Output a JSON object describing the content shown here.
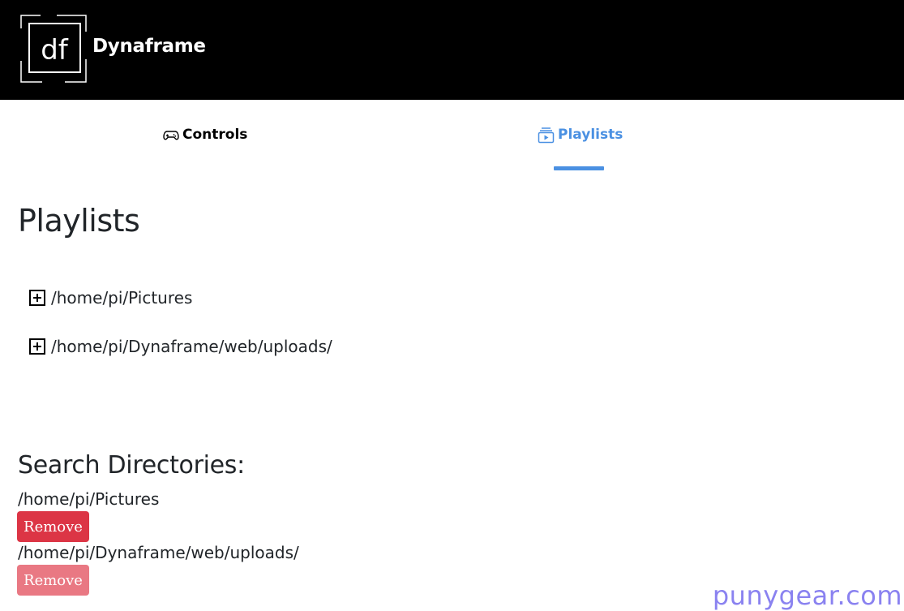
{
  "header": {
    "logo_text": "df",
    "brand": "Dynaframe"
  },
  "nav": {
    "tabs": [
      {
        "label": "Controls",
        "icon": "gamepad-icon",
        "active": false
      },
      {
        "label": "Playlists",
        "icon": "playlist-icon",
        "active": true
      }
    ],
    "active_color": "#4a90e2"
  },
  "main": {
    "title": "Playlists",
    "playlists": [
      {
        "path": "/home/pi/Pictures",
        "icon": "plus-square-icon"
      },
      {
        "path": "/home/pi/Dynaframe/web/uploads/",
        "icon": "plus-square-icon"
      }
    ],
    "search": {
      "title": "Search Directories:",
      "directories": [
        {
          "path": "/home/pi/Pictures",
          "button": "Remove",
          "button_state": "normal"
        },
        {
          "path": "/home/pi/Dynaframe/web/uploads/",
          "button": "Remove",
          "button_state": "disabled"
        }
      ]
    },
    "danger_color": "#dc3545"
  },
  "watermark": "punygear.com"
}
